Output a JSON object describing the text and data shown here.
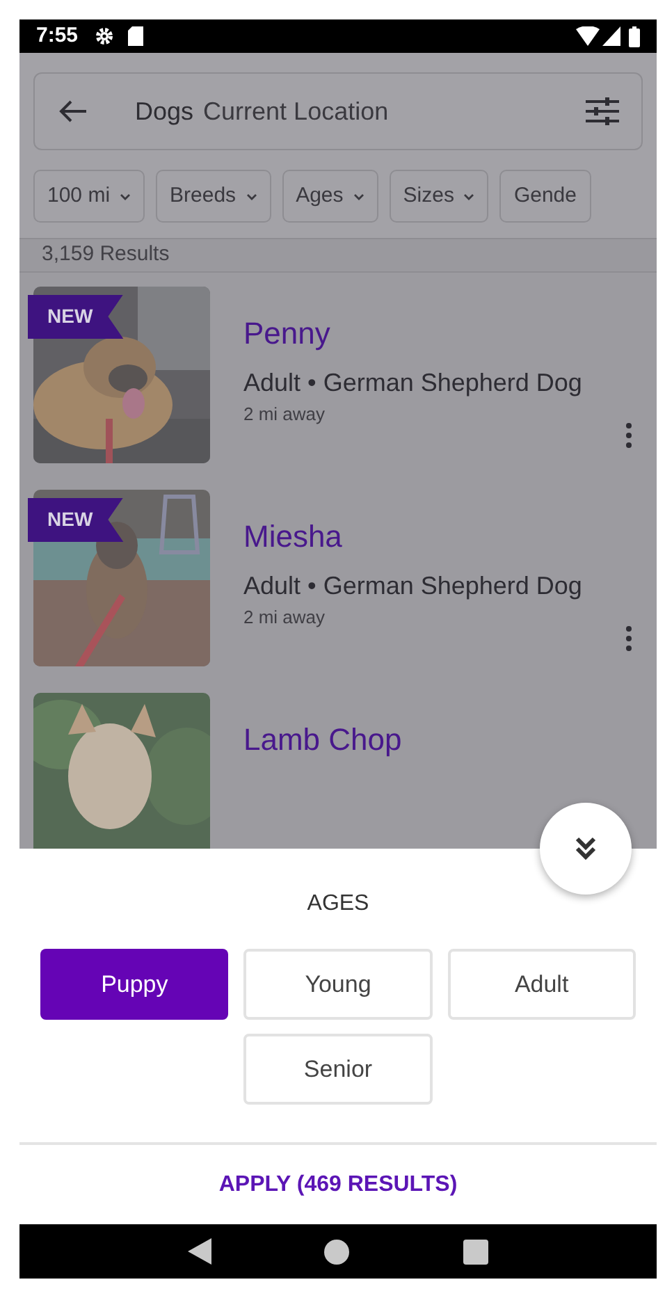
{
  "status_bar": {
    "time": "7:55"
  },
  "search": {
    "category": "Dogs",
    "location": "Current Location"
  },
  "filters": [
    {
      "label": "100 mi",
      "caret": true
    },
    {
      "label": "Breeds",
      "caret": true
    },
    {
      "label": "Ages",
      "caret": true
    },
    {
      "label": "Sizes",
      "caret": true
    },
    {
      "label": "Gende",
      "caret": false
    }
  ],
  "results_count": "3,159 Results",
  "pets": [
    {
      "name": "Penny",
      "new_badge": "NEW",
      "details": "Adult • German Shepherd Dog",
      "distance": "2 mi away"
    },
    {
      "name": "Miesha",
      "new_badge": "NEW",
      "details": "Adult • German Shepherd Dog",
      "distance": "2 mi away"
    },
    {
      "name": "Lamb Chop"
    }
  ],
  "sheet": {
    "title": "AGES",
    "options": [
      {
        "label": "Puppy",
        "selected": true
      },
      {
        "label": "Young",
        "selected": false
      },
      {
        "label": "Adult",
        "selected": false
      },
      {
        "label": "Senior",
        "selected": false
      }
    ],
    "apply": "APPLY (469 RESULTS)"
  }
}
